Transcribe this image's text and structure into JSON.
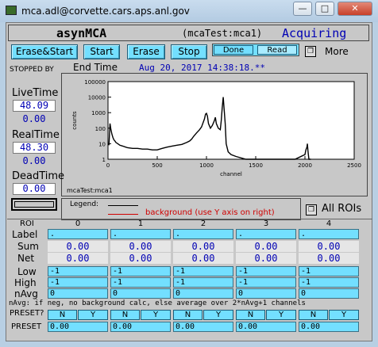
{
  "window": {
    "title": "mca.adl@corvette.cars.aps.anl.gov",
    "minimize": "—",
    "maximize": "□",
    "close": "✕"
  },
  "header": {
    "name": "asynMCA",
    "pv": "(mcaTest:mca1)",
    "status": "Acquiring"
  },
  "controls": {
    "erase_start": "Erase&Start",
    "start": "Start",
    "erase": "Erase",
    "stop": "Stop",
    "done": "Done",
    "read": "Read",
    "more": "More",
    "stopped_by": "STOPPED BY",
    "end_time_label": "End Time",
    "end_time_value": "Aug 20, 2017 14:38:18.**"
  },
  "left": {
    "live_label": "LiveTime",
    "live_value": "48.09",
    "live_elapsed": "0.00",
    "real_label": "RealTime",
    "real_value": "48.30",
    "real_elapsed": "0.00",
    "dead_label": "DeadTime",
    "dead_value": "0.00"
  },
  "chart_data": {
    "type": "line",
    "xlabel": "channel",
    "ylabel": "counts",
    "xlim": [
      0,
      2500
    ],
    "ylim": [
      1,
      100000
    ],
    "yscale": "log",
    "xticks": [
      "0",
      "500",
      "1000",
      "1500",
      "2000",
      "2500"
    ],
    "yticks": [
      "100000",
      "10000",
      "1000",
      "100",
      "10",
      "1"
    ],
    "caption": "mcaTest:mca1",
    "series": [
      {
        "name": "mcaTest:mca1",
        "x": [
          10,
          20,
          30,
          40,
          50,
          60,
          70,
          80,
          100,
          120,
          150,
          180,
          200,
          250,
          300,
          350,
          400,
          450,
          500,
          550,
          600,
          650,
          700,
          750,
          800,
          830,
          850,
          870,
          900,
          930,
          950,
          980,
          990,
          1000,
          1010,
          1020,
          1040,
          1060,
          1080,
          1090,
          1100,
          1120,
          1140,
          1150,
          1160,
          1170,
          1180,
          1190,
          1200,
          1220,
          1250,
          1300,
          1400,
          1500,
          1600,
          1700,
          1800,
          1900,
          2000,
          2010,
          2020,
          2025,
          2030,
          2035,
          2040,
          2050,
          2060
        ],
        "y": [
          8,
          200,
          80,
          40,
          25,
          18,
          15,
          12,
          10,
          8,
          7,
          6,
          5.5,
          5,
          5,
          4.5,
          4.5,
          4,
          4,
          5,
          6,
          7,
          8,
          9,
          12,
          15,
          20,
          30,
          50,
          80,
          120,
          400,
          800,
          900,
          600,
          200,
          100,
          150,
          300,
          500,
          200,
          100,
          80,
          300,
          2000,
          10000,
          1500,
          200,
          10,
          3,
          2,
          1.5,
          1,
          1,
          1,
          1,
          1,
          1,
          2,
          4,
          6,
          10,
          4,
          2,
          1,
          0,
          0
        ]
      }
    ],
    "legend_title": "Legend:",
    "legend_background": "background (use Y axis on right)"
  },
  "roi": {
    "all_rois": "All ROIs",
    "row_labels": [
      "ROI",
      "Label",
      "Sum",
      "Net",
      "Low",
      "High",
      "nAvg"
    ],
    "numbers": [
      "0",
      "1",
      "2",
      "3",
      "4"
    ],
    "label_value": ".",
    "sum": [
      "0.00",
      "0.00",
      "0.00",
      "0.00",
      "0.00"
    ],
    "net": [
      "0.00",
      "0.00",
      "0.00",
      "0.00",
      "0.00"
    ],
    "low": [
      "-1",
      "-1",
      "-1",
      "-1",
      "-1"
    ],
    "high": [
      "-1",
      "-1",
      "-1",
      "-1",
      "-1"
    ],
    "navg": [
      "0",
      "0",
      "0",
      "0",
      "0"
    ],
    "note": "nAvg: if neg, no background calc, else average over 2*nAvg+1 channels",
    "preset_q": "PRESET?",
    "preset": "PRESET",
    "n": "N",
    "y": "Y",
    "preset_values": [
      "0.00",
      "0.00",
      "0.00",
      "0.00",
      "0.00"
    ]
  },
  "colors": {
    "accent": "#73dfff",
    "value_text": "#0000b4",
    "background_line": "#d00000"
  }
}
